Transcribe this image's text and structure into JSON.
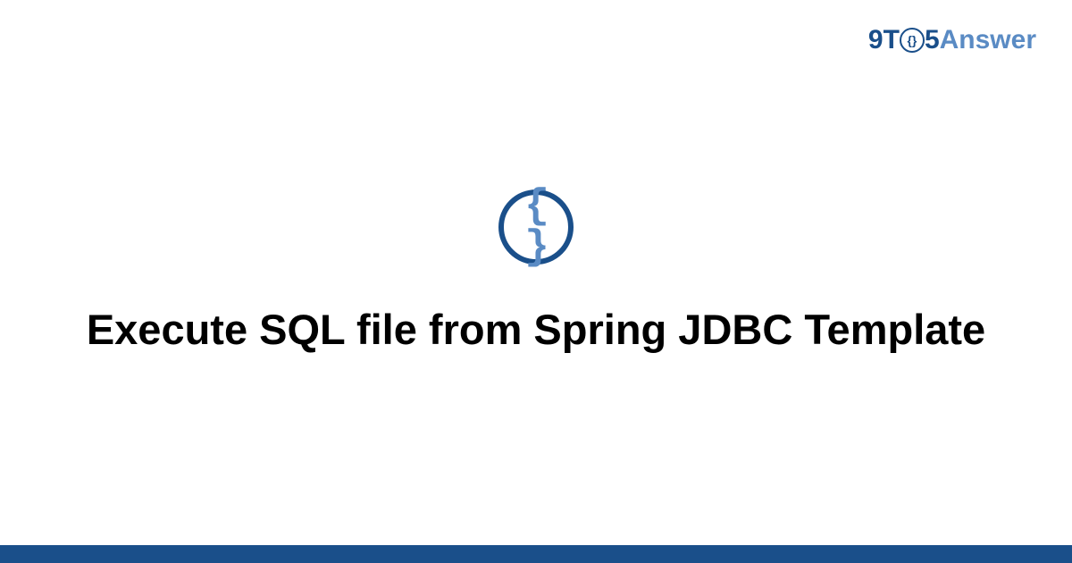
{
  "logo": {
    "part1": "9T",
    "circle_inner": "{}",
    "part2": "5",
    "part3": "Answer"
  },
  "icon": {
    "braces": "{ }"
  },
  "title": "Execute SQL file from Spring JDBC Template",
  "colors": {
    "primary": "#1a4f8a",
    "secondary": "#5a8bc4",
    "background": "#ffffff"
  }
}
